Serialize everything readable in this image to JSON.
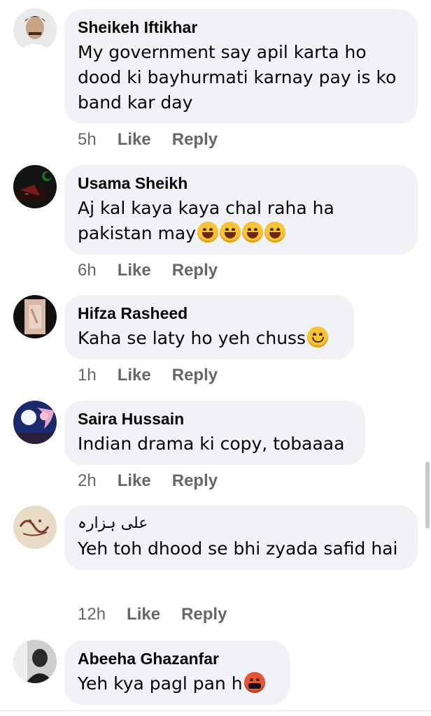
{
  "comments": [
    {
      "name": "Sheikeh Iftikhar",
      "text": "My government say apil karta ho dood ki bayhurmati karnay pay is ko band kar day",
      "time": "5h",
      "like": "Like",
      "reply": "Reply",
      "avatar": "profile-photo-man"
    },
    {
      "name": "Usama Sheikh",
      "text": "Aj kal kaya kaya chal raha ha pakistan may",
      "emojis": [
        "rolling-laughing",
        "rolling-laughing",
        "tears-of-joy",
        "tears-of-joy"
      ],
      "time": "6h",
      "like": "Like",
      "reply": "Reply",
      "avatar": "flag-photo"
    },
    {
      "name": "Hifza Rasheed",
      "text": "Kaha se laty ho yeh chuss",
      "emojis": [
        "slight-smile"
      ],
      "time": "1h",
      "like": "Like",
      "reply": "Reply",
      "avatar": "pink-photo"
    },
    {
      "name": "Saira Hussain",
      "text": "Indian drama ki copy, tobaaaa",
      "time": "2h",
      "like": "Like",
      "reply": "Reply",
      "avatar": "moon-blossom-photo"
    },
    {
      "name": "علی ہزارہ",
      "text": "Yeh toh dhood se bhi zyada safid hai",
      "time": "12h",
      "like": "Like",
      "reply": "Reply",
      "avatar": "calligraphy-photo"
    },
    {
      "name": "Abeeha Ghazanfar",
      "text": "Yeh kya pagl pan h",
      "emojis": [
        "cursing-face"
      ],
      "time": "",
      "like": "",
      "reply": "",
      "avatar": "silhouette-photo"
    }
  ],
  "colors": {
    "bubble": "#f0f2f5",
    "meta": "#65676b",
    "text": "#050505"
  }
}
